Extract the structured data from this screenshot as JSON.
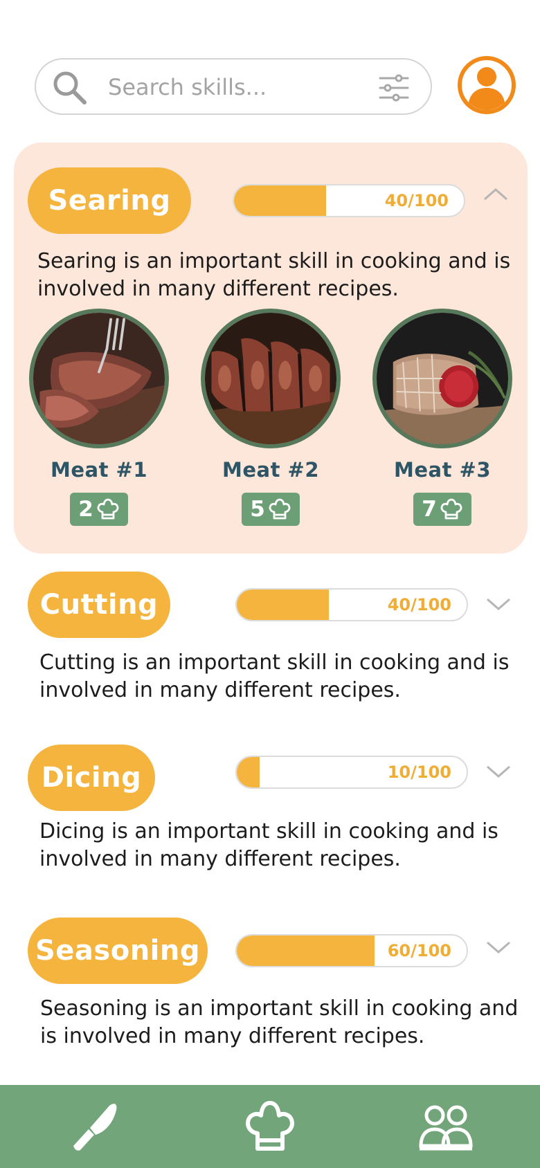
{
  "search": {
    "placeholder": "Search skills..."
  },
  "icons": {
    "search": "search-icon",
    "filter": "filter-sliders-icon",
    "profile": "user-avatar-icon",
    "badge": "chef-hat-icon",
    "nav": [
      "knife-icon",
      "chef-hat-icon",
      "people-icon"
    ]
  },
  "colors": {
    "accent": "#f4b43e",
    "open_panel": "#fde6da",
    "meat_name": "#2e5566",
    "badge_bg": "#6d9f76",
    "nav_bg": "#73a57a",
    "avatar": "#f28a1a"
  },
  "skills": [
    {
      "name": "Searing",
      "progress_text": "40/100",
      "progress": 0.4,
      "expanded": true,
      "description": "Searing is an important skill in cooking and is involved in many different recipes.",
      "meats": [
        {
          "name": "Meat #1",
          "count": "2"
        },
        {
          "name": "Meat #2",
          "count": "5"
        },
        {
          "name": "Meat #3",
          "count": "7"
        }
      ]
    },
    {
      "name": "Cutting",
      "progress_text": "40/100",
      "progress": 0.4,
      "expanded": false,
      "description": "Cutting is an important skill in cooking and is involved in many different recipes."
    },
    {
      "name": "Dicing",
      "progress_text": "10/100",
      "progress": 0.1,
      "expanded": false,
      "description": "Dicing is an important skill in cooking and is involved in many different recipes."
    },
    {
      "name": "Seasoning",
      "progress_text": "60/100",
      "progress": 0.6,
      "expanded": false,
      "description": "Seasoning is an important skill in cooking and is involved in many different recipes."
    }
  ]
}
